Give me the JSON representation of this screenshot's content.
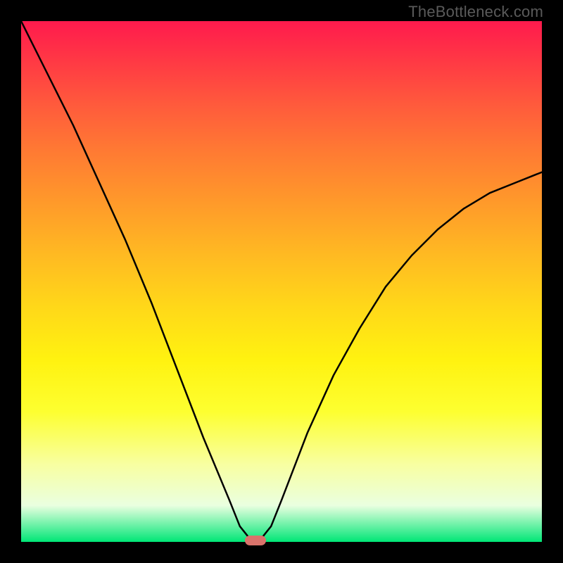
{
  "watermark": "TheBottleneck.com",
  "gradient_colors": {
    "top": "#ff1a4d",
    "mid_orange": "#ff9a2a",
    "mid_yellow": "#fff210",
    "pale": "#f8ffa0",
    "bottom": "#00e676"
  },
  "chart_data": {
    "type": "line",
    "title": "",
    "xlabel": "",
    "ylabel": "",
    "xlim": [
      0,
      100
    ],
    "ylim": [
      0,
      100
    ],
    "x": [
      0,
      5,
      10,
      15,
      20,
      25,
      30,
      35,
      40,
      42,
      44,
      45,
      46,
      48,
      50,
      55,
      60,
      65,
      70,
      75,
      80,
      85,
      90,
      95,
      100
    ],
    "values": [
      100,
      90,
      80,
      69,
      58,
      46,
      33,
      20,
      8,
      3,
      0.5,
      0,
      0.5,
      3,
      8,
      21,
      32,
      41,
      49,
      55,
      60,
      64,
      67,
      69,
      71
    ],
    "marker": {
      "x": 45,
      "y": 0
    },
    "grid": false,
    "legend": false
  }
}
